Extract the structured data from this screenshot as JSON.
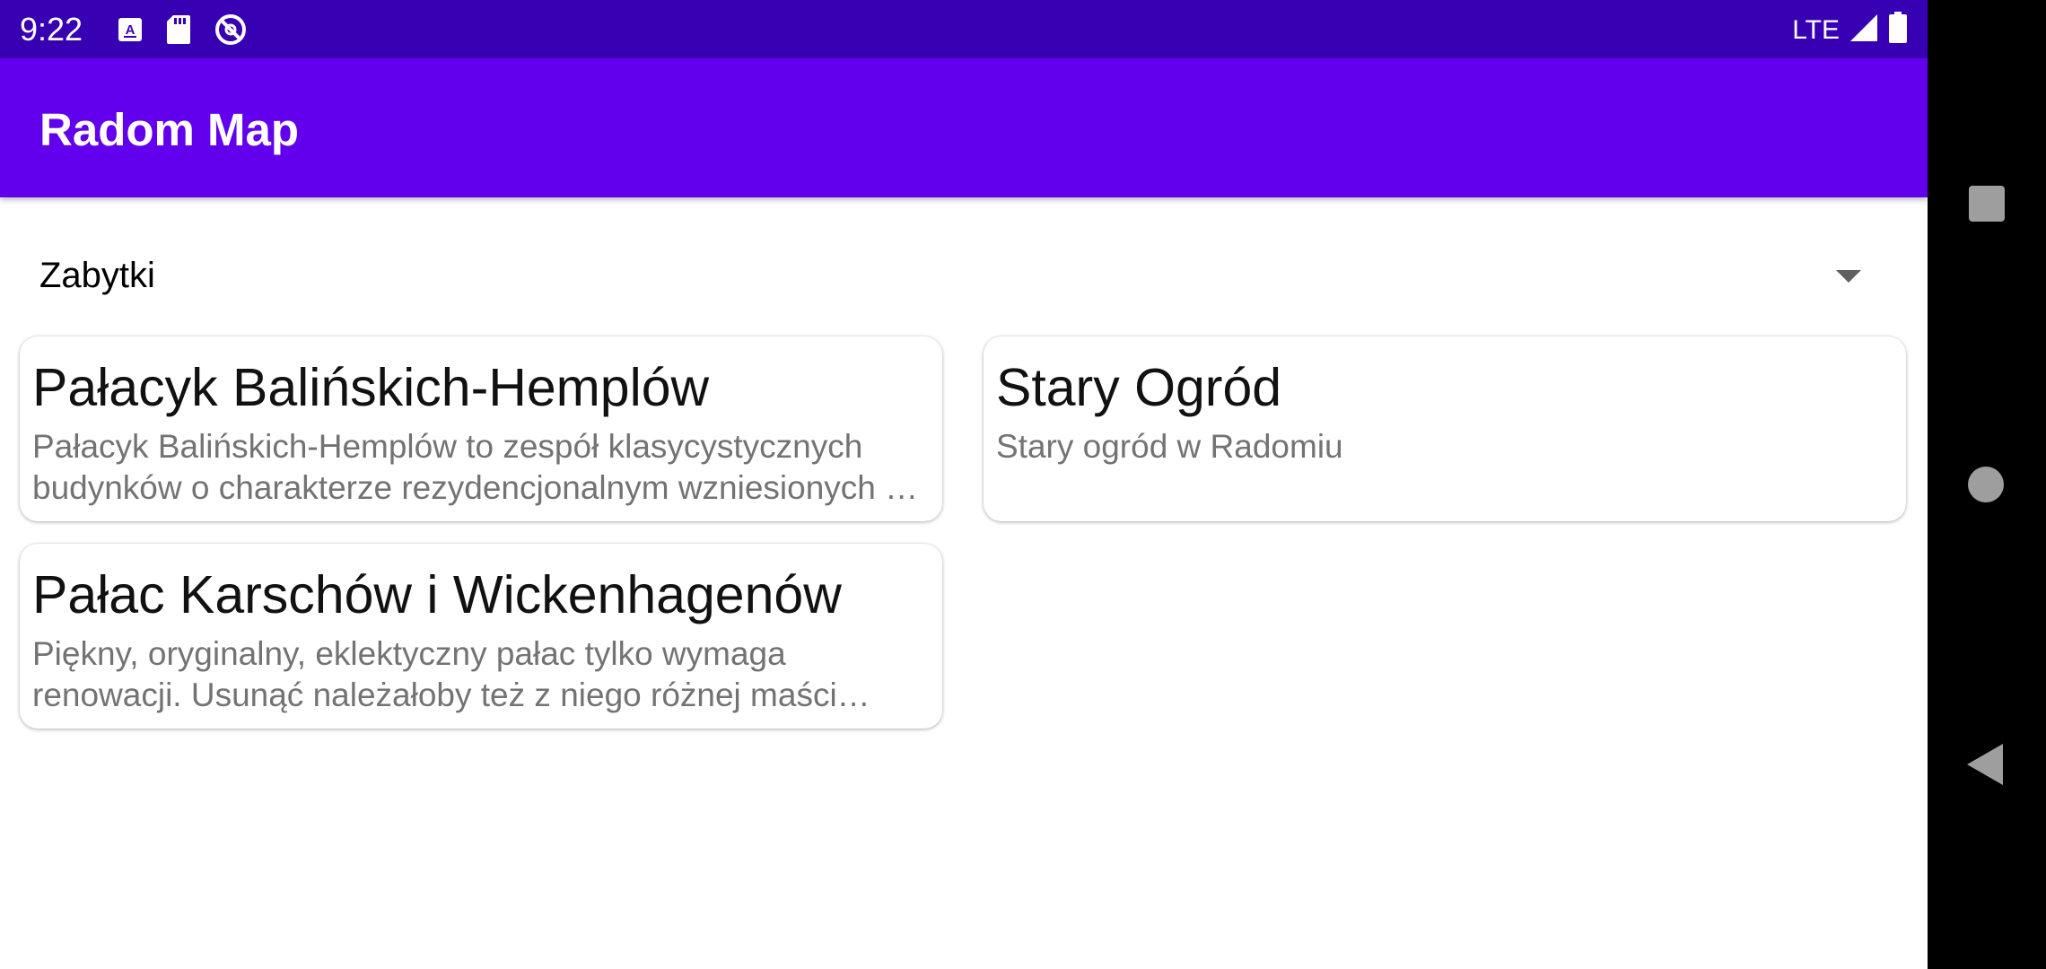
{
  "status_bar": {
    "time": "9:22",
    "network": "LTE",
    "icons_left": [
      "text-recognition-icon",
      "sd-card-icon",
      "do-not-disturb-icon"
    ],
    "icons_right": [
      "signal-icon",
      "battery-icon"
    ]
  },
  "app_bar": {
    "title": "Radom Map"
  },
  "spinner": {
    "selected": "Zabytki"
  },
  "places": [
    {
      "title": "Pałacyk Balińskich-Hemplów",
      "description": "Pałacyk Balińskich-Hemplów to zespół klasycystycznych budynków o charakterze rezydencjonalnym wzniesionych w Radomiu"
    },
    {
      "title": "Stary Ogród",
      "description": "Stary ogród w Radomiu"
    },
    {
      "title": "Pałac Karschów i Wickenhagenów",
      "description": "Piękny, oryginalny, eklektyczny pałac tylko wymaga renowacji. Usunąć należałoby też z niego różnej maści reklamy"
    }
  ],
  "colors": {
    "status_bar": "#3700b3",
    "app_bar": "#6200ee",
    "nav_bar": "#000000"
  },
  "nav_bar": {
    "buttons": [
      "recent-apps",
      "home",
      "back"
    ]
  }
}
